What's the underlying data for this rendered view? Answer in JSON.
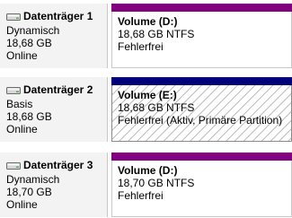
{
  "colors": {
    "dynamic_bar": "#800080",
    "basic_primary_bar": "#00007b"
  },
  "disks": [
    {
      "name": "Datenträger 1",
      "type": "Dynamisch",
      "size": "18,68 GB",
      "status": "Online",
      "icon": "hard-disk-icon",
      "volume": {
        "name": "Volume  (D:)",
        "info": "18,68 GB NTFS",
        "status": "Fehlerfrei"
      }
    },
    {
      "name": "Datenträger 2",
      "type": "Basis",
      "size": "18,68 GB",
      "status": "Online",
      "icon": "hard-disk-icon",
      "volume": {
        "name": "Volume  (E:)",
        "info": "18,68 GB NTFS",
        "status": "Fehlerfrei (Aktiv, Primäre Partition)"
      }
    },
    {
      "name": "Datenträger 3",
      "type": "Dynamisch",
      "size": "18,70 GB",
      "status": "Online",
      "icon": "hard-disk-icon",
      "volume": {
        "name": "Volume  (D:)",
        "info": "18,70 GB NTFS",
        "status": "Fehlerfrei"
      }
    }
  ]
}
